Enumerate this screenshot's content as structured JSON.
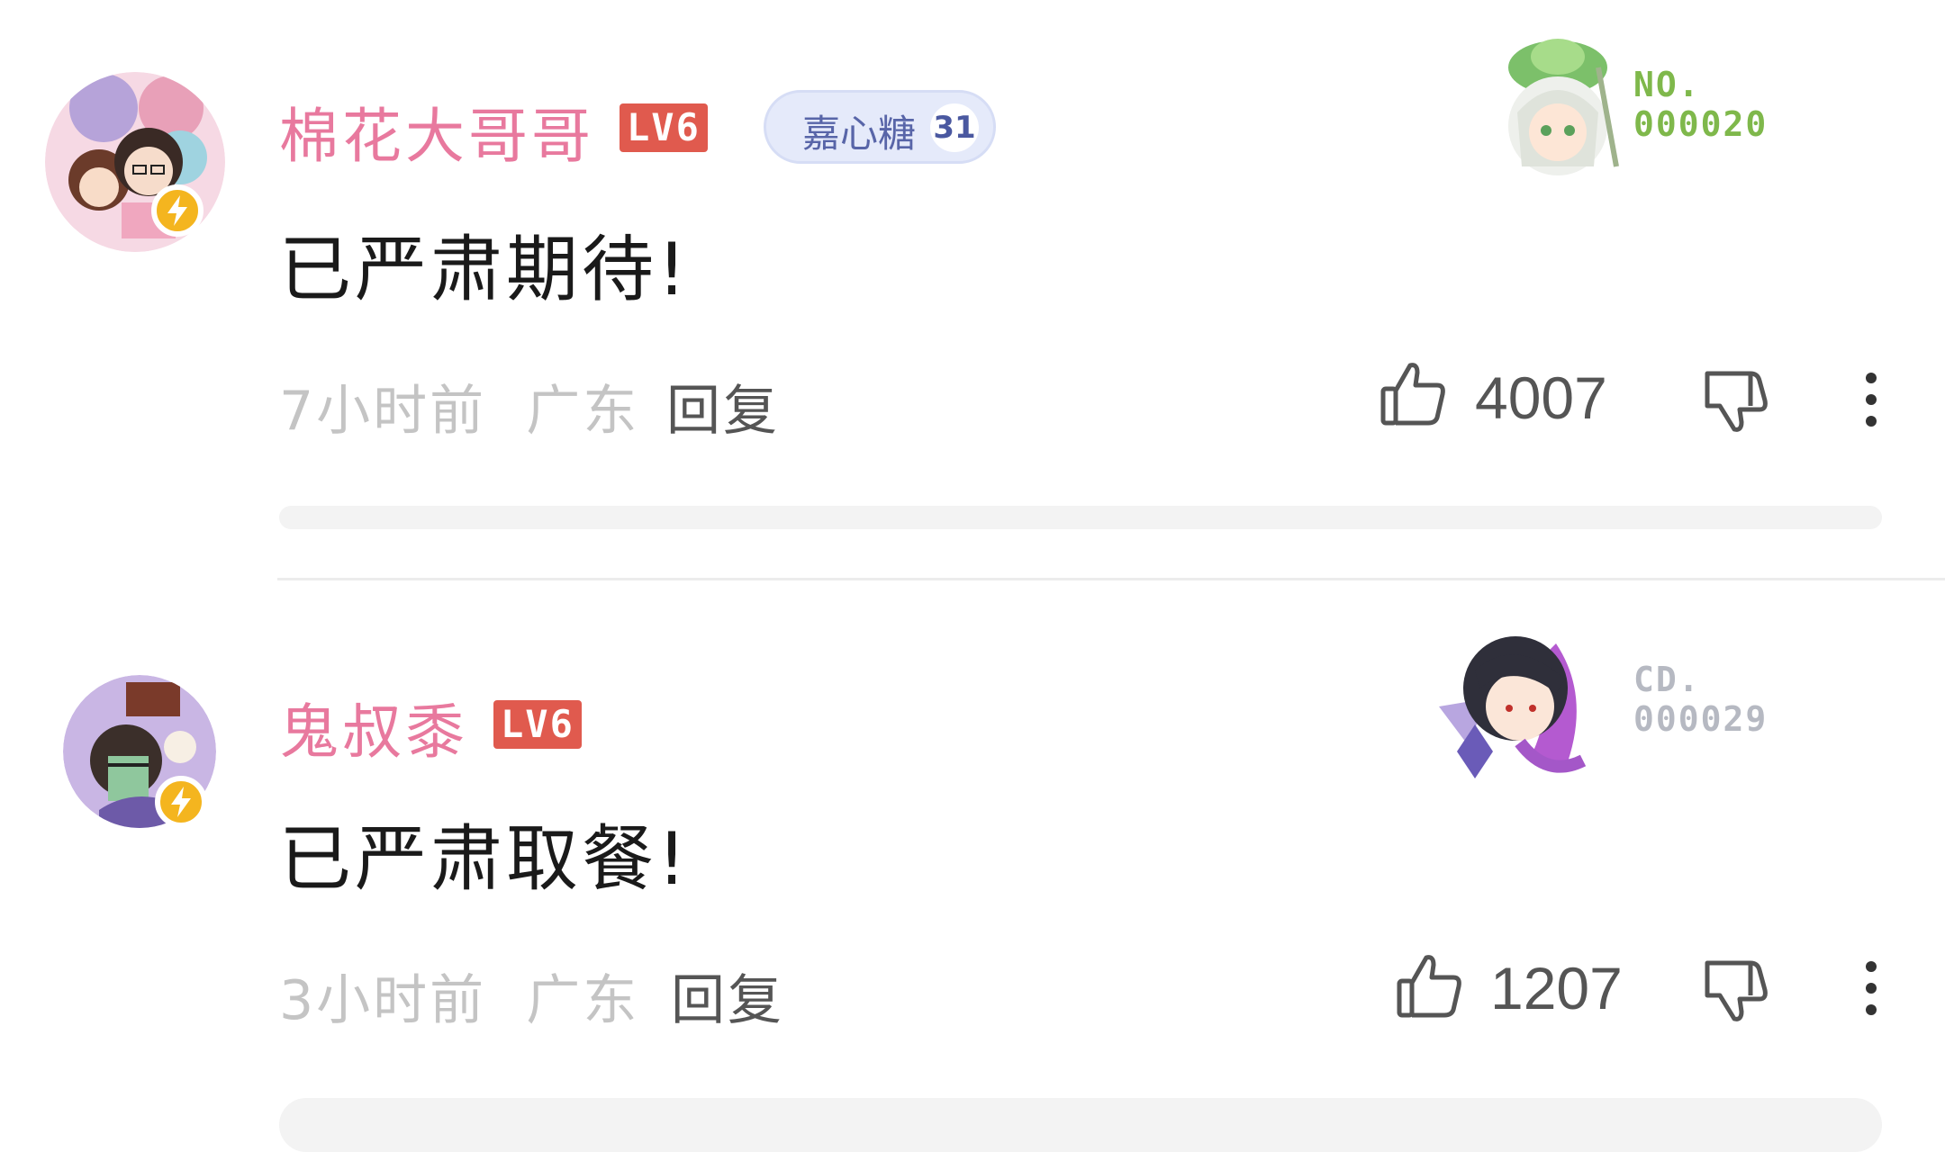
{
  "comments": [
    {
      "username": "棉花大哥哥",
      "level": "LV6",
      "fan_badge": {
        "name": "嘉心糖",
        "level": "31"
      },
      "text": "已严肃期待!",
      "time": "7小时前",
      "location": "广东",
      "reply_label": "回复",
      "likes": "4007",
      "decoration": {
        "label": "NO.",
        "number": "000020",
        "color": "#7fb84b"
      }
    },
    {
      "username": "鬼叔黍",
      "level": "LV6",
      "text": "已严肃取餐!",
      "time": "3小时前",
      "location": "广东",
      "reply_label": "回复",
      "likes": "1207",
      "decoration": {
        "label": "CD.",
        "number": "000029",
        "color": "#b6b9c2"
      }
    }
  ],
  "colors": {
    "username": "#e8799e",
    "level_badge": "#e05a4e",
    "fan_badge_bg": "#e5eafa",
    "meta_text": "#c4c4c4",
    "action_text": "#555555"
  },
  "icons": [
    "lightning-icon",
    "thumbs-up-icon",
    "thumbs-down-icon",
    "more-vertical-icon"
  ]
}
